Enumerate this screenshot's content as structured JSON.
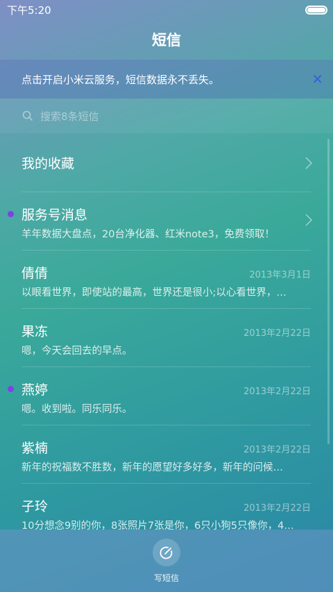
{
  "status_bar": {
    "time": "下午5:20",
    "battery_icon": "battery-icon"
  },
  "header": {
    "title": "短信"
  },
  "banner": {
    "text": "点击开启小米云服务，短信数据永不丢失。",
    "close_icon": "close-icon"
  },
  "search": {
    "placeholder": "搜索8条短信",
    "icon": "search-icon"
  },
  "favorites": {
    "label": "我的收藏",
    "chevron_icon": "chevron-right-icon"
  },
  "conversations": [
    {
      "name": "服务号消息",
      "preview": "羊年数据大盘点，20台净化器、红米note3，免费领取！",
      "date": "",
      "unread": true,
      "chevron": true
    },
    {
      "name": "倩倩",
      "preview": "以眼看世界，即使站的最高，世界还是很小;以心看世界，…",
      "date": "2013年3月1日",
      "unread": false
    },
    {
      "name": "果冻",
      "preview": "嗯，今天会回去的早点。",
      "date": "2013年2月22日",
      "unread": false
    },
    {
      "name": "燕婷",
      "preview": "嗯。收到啦。同乐同乐。",
      "date": "2013年2月22日",
      "unread": true
    },
    {
      "name": "紫楠",
      "preview": "新年的祝福数不胜数，新年的愿望好多好多，新年的问候…",
      "date": "2013年2月22日",
      "unread": false
    },
    {
      "name": "子玲",
      "preview": "10分想念9别的你，8张照片7张是你，6只小狗5只像你，4…",
      "date": "2013年2月22日",
      "unread": false
    }
  ],
  "bottom_bar": {
    "compose_label": "写短信",
    "compose_icon": "compose-icon"
  },
  "colors": {
    "unread_dot": "#8040e8",
    "banner_close": "#3c5fd6"
  }
}
